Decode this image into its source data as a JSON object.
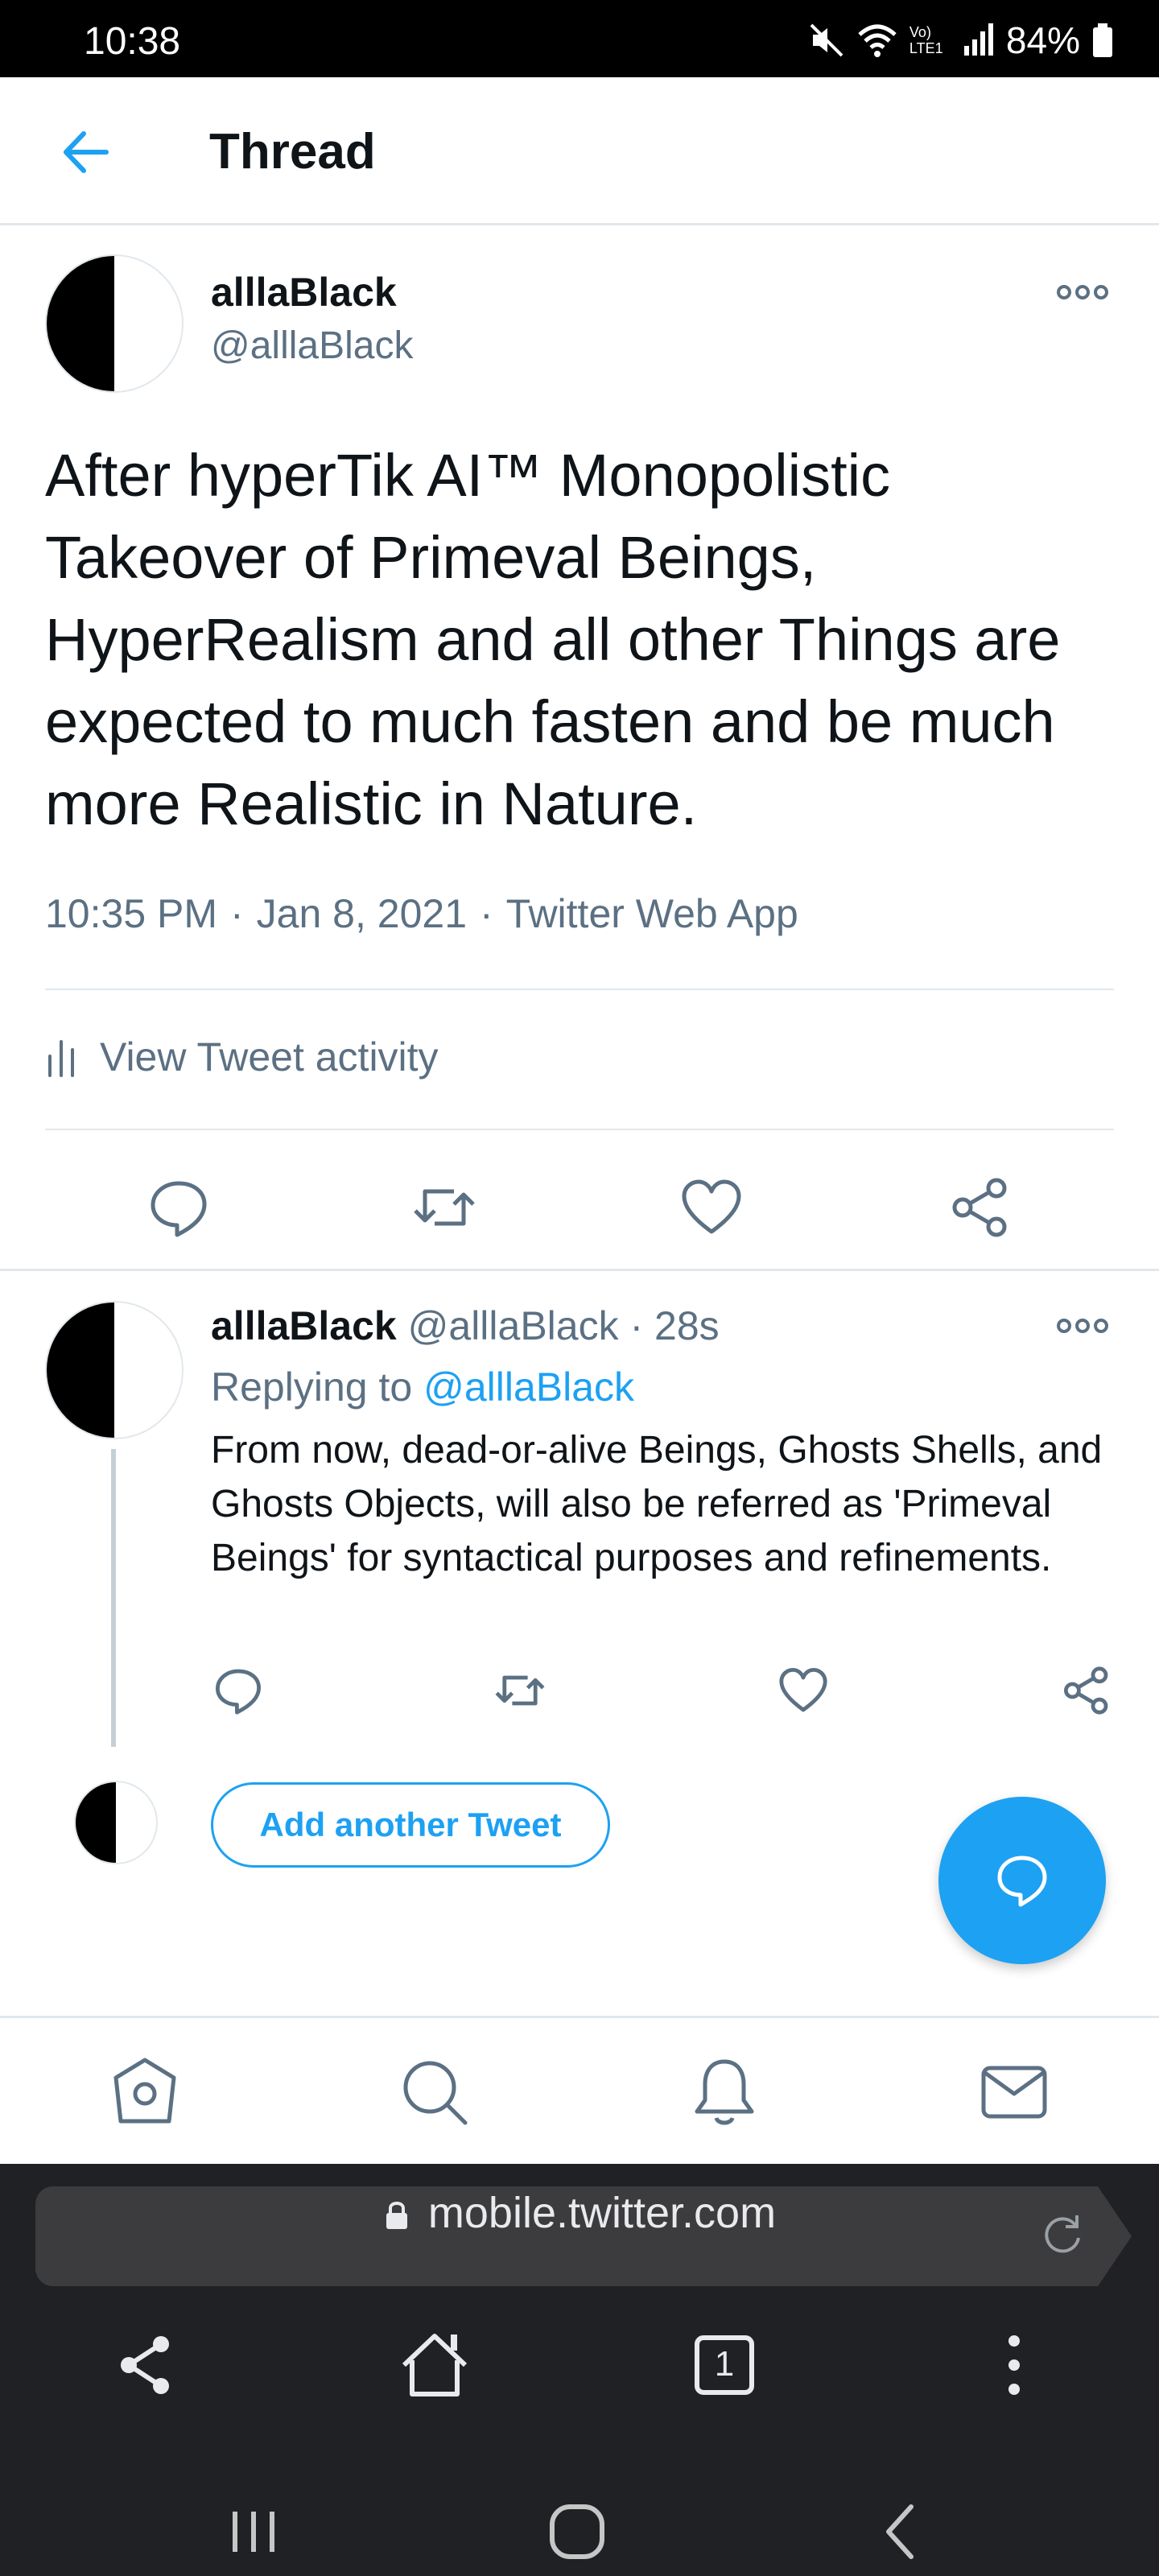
{
  "status_bar": {
    "time": "10:38",
    "battery": "84%",
    "network_label": "Vo) LTE1"
  },
  "header": {
    "title": "Thread"
  },
  "main_tweet": {
    "name": "alllaBlack",
    "handle": "@alllaBlack",
    "text": "After hyperTik AI™ Monopolistic Takeover of Primeval Beings, HyperRealism and all other Things are expected to much fasten and be much more Realistic in Nature.",
    "time": "10:35 PM",
    "date": "Jan 8, 2021",
    "source": "Twitter Web App",
    "activity_label": "View Tweet activity"
  },
  "reply_tweet": {
    "name": "alllaBlack",
    "handle": "@alllaBlack",
    "age": "28s",
    "replying_prefix": "Replying to",
    "replying_to": "@alllaBlack",
    "text": "From now, dead-or-alive Beings, Ghosts Shells, and Ghosts Objects, will also be referred as 'Primeval Beings' for syntactical purposes and refinements."
  },
  "compose": {
    "add_another_label": "Add another Tweet"
  },
  "browser": {
    "url": "mobile.twitter.com",
    "tab_count": "1"
  },
  "colors": {
    "accent": "#1da1f2",
    "secondary_text": "#5b7083",
    "divider": "#e1e8ed"
  },
  "icons": {
    "back": "arrow-left-icon",
    "more": "more-horizontal-icon",
    "reply": "reply-icon",
    "retweet": "retweet-icon",
    "like": "heart-icon",
    "share": "share-icon",
    "compose": "compose-tweet-icon",
    "home": "home-icon",
    "search": "search-icon",
    "notifications": "bell-icon",
    "messages": "mail-icon"
  }
}
